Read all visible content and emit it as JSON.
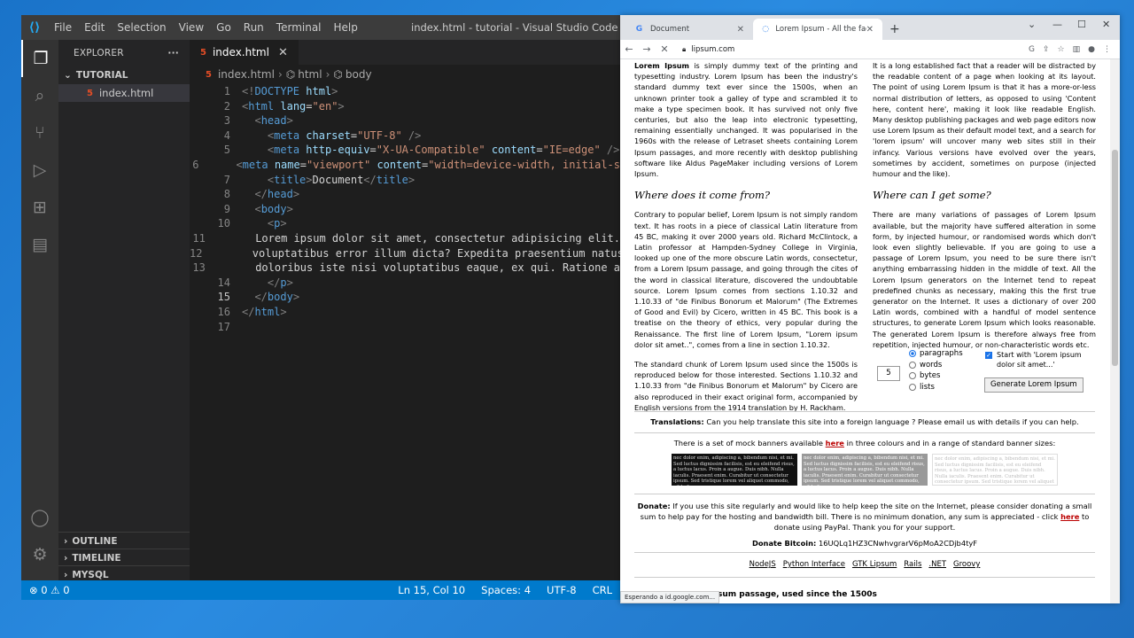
{
  "vscode": {
    "menu": [
      "File",
      "Edit",
      "Selection",
      "View",
      "Go",
      "Run",
      "Terminal",
      "Help"
    ],
    "window_title": "index.html - tutorial - Visual Studio Code",
    "explorer": {
      "title": "EXPLORER",
      "more": "···",
      "folder": "TUTORIAL",
      "file": "index.html",
      "sections": [
        "OUTLINE",
        "TIMELINE",
        "MYSQL"
      ]
    },
    "tab": {
      "label": "index.html",
      "close": "✕"
    },
    "breadcrumb": [
      "index.html",
      "html",
      "body"
    ],
    "lines": [
      [
        [
          "br",
          "<!"
        ],
        [
          "tag",
          "DOCTYPE"
        ],
        [
          "txt",
          " "
        ],
        [
          "attr",
          "html"
        ],
        [
          "br",
          ">"
        ]
      ],
      [
        [
          "br",
          "<"
        ],
        [
          "tag",
          "html"
        ],
        [
          "txt",
          " "
        ],
        [
          "attr",
          "lang"
        ],
        [
          "txt",
          "="
        ],
        [
          "val",
          "\"en\""
        ],
        [
          "br",
          ">"
        ]
      ],
      [
        [
          "txt",
          "  "
        ],
        [
          "br",
          "<"
        ],
        [
          "tag",
          "head"
        ],
        [
          "br",
          ">"
        ]
      ],
      [
        [
          "txt",
          "    "
        ],
        [
          "br",
          "<"
        ],
        [
          "tag",
          "meta"
        ],
        [
          "txt",
          " "
        ],
        [
          "attr",
          "charset"
        ],
        [
          "txt",
          "="
        ],
        [
          "val",
          "\"UTF-8\""
        ],
        [
          "txt",
          " "
        ],
        [
          "br",
          "/>"
        ]
      ],
      [
        [
          "txt",
          "    "
        ],
        [
          "br",
          "<"
        ],
        [
          "tag",
          "meta"
        ],
        [
          "txt",
          " "
        ],
        [
          "attr",
          "http-equiv"
        ],
        [
          "txt",
          "="
        ],
        [
          "val",
          "\"X-UA-Compatible\""
        ],
        [
          "txt",
          " "
        ],
        [
          "attr",
          "content"
        ],
        [
          "txt",
          "="
        ],
        [
          "val",
          "\"IE=edge\""
        ],
        [
          "txt",
          " "
        ],
        [
          "br",
          "/>"
        ]
      ],
      [
        [
          "txt",
          "    "
        ],
        [
          "br",
          "<"
        ],
        [
          "tag",
          "meta"
        ],
        [
          "txt",
          " "
        ],
        [
          "attr",
          "name"
        ],
        [
          "txt",
          "="
        ],
        [
          "val",
          "\"viewport\""
        ],
        [
          "txt",
          " "
        ],
        [
          "attr",
          "content"
        ],
        [
          "txt",
          "="
        ],
        [
          "val",
          "\"width=device-width, initial-s"
        ]
      ],
      [
        [
          "txt",
          "    "
        ],
        [
          "br",
          "<"
        ],
        [
          "tag",
          "title"
        ],
        [
          "br",
          ">"
        ],
        [
          "txt",
          "Document"
        ],
        [
          "br",
          "</"
        ],
        [
          "tag",
          "title"
        ],
        [
          "br",
          ">"
        ]
      ],
      [
        [
          "txt",
          "  "
        ],
        [
          "br",
          "</"
        ],
        [
          "tag",
          "head"
        ],
        [
          "br",
          ">"
        ]
      ],
      [
        [
          "txt",
          "  "
        ],
        [
          "br",
          "<"
        ],
        [
          "tag",
          "body"
        ],
        [
          "br",
          ">"
        ]
      ],
      [
        [
          "txt",
          "    "
        ],
        [
          "br",
          "<"
        ],
        [
          "tag",
          "p"
        ],
        [
          "br",
          ">"
        ]
      ],
      [
        [
          "txt",
          "      Lorem ipsum dolor sit amet, consectetur adipisicing elit."
        ]
      ],
      [
        [
          "txt",
          "      voluptatibus error illum dicta? Expedita praesentium natus"
        ]
      ],
      [
        [
          "txt",
          "      doloribus iste nisi voluptatibus eaque, ex qui. Ratione a"
        ]
      ],
      [
        [
          "txt",
          "    "
        ],
        [
          "br",
          "</"
        ],
        [
          "tag",
          "p"
        ],
        [
          "br",
          ">"
        ]
      ],
      [
        [
          "txt",
          "  "
        ],
        [
          "br",
          "</"
        ],
        [
          "tag",
          "body"
        ],
        [
          "br",
          ">"
        ]
      ],
      [
        [
          "br",
          "</"
        ],
        [
          "tag",
          "html"
        ],
        [
          "br",
          ">"
        ]
      ],
      []
    ],
    "current_line": 15,
    "status": {
      "problems": "⊗ 0 ⚠ 0",
      "position": "Ln 15, Col 10",
      "spaces": "Spaces: 4",
      "encoding": "UTF-8",
      "eol": "CRL"
    }
  },
  "chrome": {
    "tabs": [
      {
        "title": "Document",
        "close": "✕",
        "icon": "google-g-icon"
      },
      {
        "title": "Lorem Ipsum - All the facts - Lip",
        "close": "✕",
        "icon": "loading-spinner-icon"
      }
    ],
    "url": "lipsum.com",
    "status_text": "Esperando a id.google.com...",
    "page": {
      "left_p1_bold": "Lorem Ipsum",
      "left_p1": " is simply dummy text of the printing and typesetting industry. Lorem Ipsum has been the industry's standard dummy text ever since the 1500s, when an unknown printer took a galley of type and scrambled it to make a type specimen book. It has survived not only five centuries, but also the leap into electronic typesetting, remaining essentially unchanged. It was popularised in the 1960s with the release of Letraset sheets containing Lorem Ipsum passages, and more recently with desktop publishing software like Aldus PageMaker including versions of Lorem Ipsum.",
      "left_h2": "Where does it come from?",
      "left_p2": "Contrary to popular belief, Lorem Ipsum is not simply random text. It has roots in a piece of classical Latin literature from 45 BC, making it over 2000 years old. Richard McClintock, a Latin professor at Hampden-Sydney College in Virginia, looked up one of the more obscure Latin words, consectetur, from a Lorem Ipsum passage, and going through the cites of the word in classical literature, discovered the undoubtable source. Lorem Ipsum comes from sections 1.10.32 and 1.10.33 of \"de Finibus Bonorum et Malorum\" (The Extremes of Good and Evil) by Cicero, written in 45 BC. This book is a treatise on the theory of ethics, very popular during the Renaissance. The first line of Lorem Ipsum, \"Lorem ipsum dolor sit amet..\", comes from a line in section 1.10.32.",
      "left_p3": "The standard chunk of Lorem Ipsum used since the 1500s is reproduced below for those interested. Sections 1.10.32 and 1.10.33 from \"de Finibus Bonorum et Malorum\" by Cicero are also reproduced in their exact original form, accompanied by English versions from the 1914 translation by H. Rackham.",
      "right_p1": "It is a long established fact that a reader will be distracted by the readable content of a page when looking at its layout. The point of using Lorem Ipsum is that it has a more-or-less normal distribution of letters, as opposed to using 'Content here, content here', making it look like readable English. Many desktop publishing packages and web page editors now use Lorem Ipsum as their default model text, and a search for 'lorem ipsum' will uncover many web sites still in their infancy. Various versions have evolved over the years, sometimes by accident, sometimes on purpose (injected humour and the like).",
      "right_h2": "Where can I get some?",
      "right_p2": "There are many variations of passages of Lorem Ipsum available, but the majority have suffered alteration in some form, by injected humour, or randomised words which don't look even slightly believable. If you are going to use a passage of Lorem Ipsum, you need to be sure there isn't anything embarrassing hidden in the middle of text. All the Lorem Ipsum generators on the Internet tend to repeat predefined chunks as necessary, making this the first true generator on the Internet. It uses a dictionary of over 200 Latin words, combined with a handful of model sentence structures, to generate Lorem Ipsum which looks reasonable. The generated Lorem Ipsum is therefore always free from repetition, injected humour, or non-characteristic words etc.",
      "generator": {
        "amount": "5",
        "options": [
          "paragraphs",
          "words",
          "bytes",
          "lists"
        ],
        "checkbox_label": "Start with 'Lorem ipsum dolor sit amet...'",
        "button": "Generate Lorem Ipsum"
      },
      "translations_label": "Translations:",
      "translations_text": " Can you help translate this site into a foreign language ? Please email us with details if you can help.",
      "banners_pre": "There is a set of mock banners available ",
      "banners_link": "here",
      "banners_post": " in three colours and in a range of standard banner sizes:",
      "banner_text": "nec dolor enim, adipiscing a, bibendum nisi, et mi. Sed luctus dignissim facilisis, est eu eleifend risus, a luctus lacus. Proin a augue. Duis nibh. Nulla iaculis. Praesent enim. Curabitur ut consectetur ipsum. Sed tristique lorem vel aliquet commodo, nibh diam.",
      "donate_label": "Donate:",
      "donate_pre": " If you use this site regularly and would like to help keep the site on the Internet, please consider donating a small sum to help pay for the hosting and bandwidth bill. There is no minimum donation, any sum is appreciated - click ",
      "donate_link": "here",
      "donate_post": " to donate using PayPal. Thank you for your support.",
      "bitcoin_label": "Donate Bitcoin:",
      "bitcoin_addr": " 16UQLq1HZ3CNwhvgrarV6pMoA2CDjb4tyF",
      "footer_links": [
        "NodeJS",
        "Python Interface",
        "GTK Lipsum",
        "Rails",
        ".NET",
        "Groovy"
      ],
      "bottom_heading": "sum passage, used since the 1500s"
    }
  },
  "colors": {
    "vscode_bg": "#1e1e1e",
    "statusbar": "#007acc",
    "desktop": "#1a73c9"
  }
}
